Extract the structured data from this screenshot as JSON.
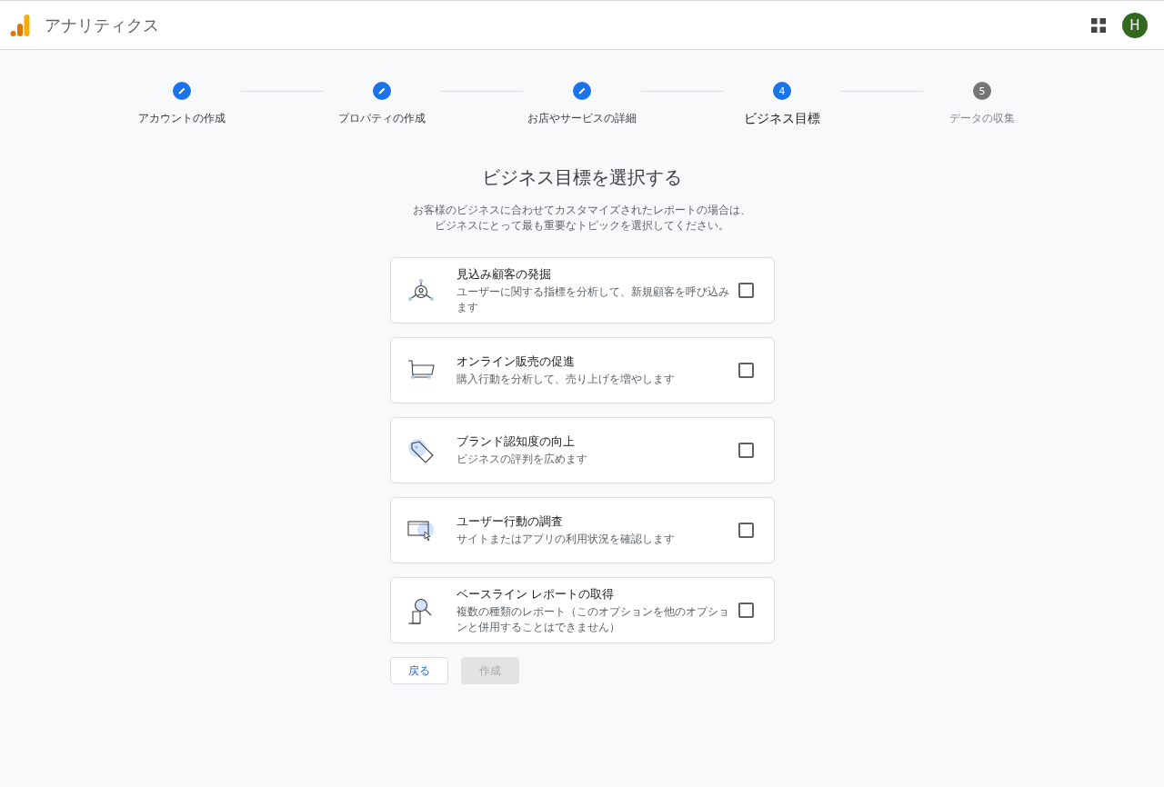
{
  "app": {
    "title": "アナリティクス",
    "avatar": "H"
  },
  "steps": [
    {
      "label": "アカウントの作成",
      "kind": "done"
    },
    {
      "label": "プロパティの作成",
      "kind": "done"
    },
    {
      "label": "お店やサービスの詳細",
      "kind": "done"
    },
    {
      "label": "ビジネス目標",
      "kind": "current",
      "number": "4"
    },
    {
      "label": "データの収集",
      "kind": "upcoming",
      "number": "5"
    }
  ],
  "heading": "ビジネス目標を選択する",
  "description": [
    "お客様のビジネスに合わせてカスタマイズされたレポートの場合は、",
    "ビジネスにとって最も重要なトピックを選択してください。"
  ],
  "options": [
    {
      "kind": "leads",
      "title": "見込み顧客の発掘",
      "text": "ユーザーに関する指標を分析して、新規顧客を呼び込みます",
      "checked": false
    },
    {
      "kind": "sales",
      "title": "オンライン販売の促進",
      "text": "購入行動を分析して、売り上げを増やします",
      "checked": false
    },
    {
      "kind": "brand",
      "title": "ブランド認知度の向上",
      "text": "ビジネスの評判を広めます",
      "checked": false
    },
    {
      "kind": "behavior",
      "title": "ユーザー行動の調査",
      "text": "サイトまたはアプリの利用状況を確認します",
      "checked": false
    },
    {
      "kind": "baseline",
      "title": "ベースライン レポートの取得",
      "text": "複数の種類のレポート（このオプションを他のオプションと併用することはできません）",
      "checked": false
    }
  ],
  "buttons": {
    "back": {
      "label": "戻る"
    },
    "create": {
      "label": "作成",
      "disabled": true
    }
  }
}
